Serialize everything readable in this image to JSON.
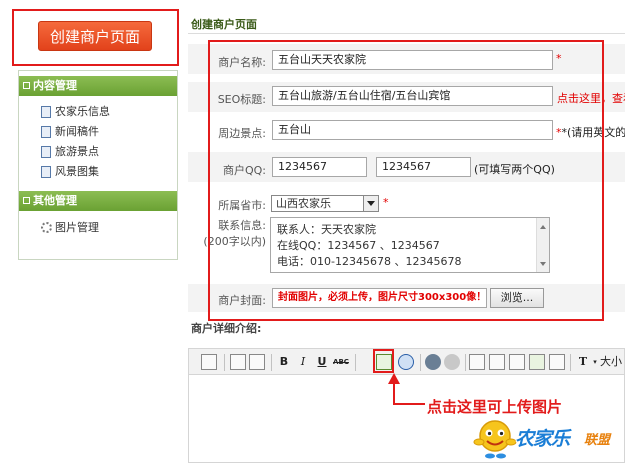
{
  "create_button": {
    "label": "创建商户页面"
  },
  "sidebar": {
    "sections": [
      {
        "title": "内容管理",
        "items": [
          "农家乐信息",
          "新闻稿件",
          "旅游景点",
          "风景图集"
        ]
      },
      {
        "title": "其他管理",
        "items": [
          "图片管理"
        ]
      }
    ]
  },
  "page_title": "创建商户页面",
  "form": {
    "name_label": "商户名称:",
    "name_value": "五台山天天农家院",
    "seo_label": "SEO标题:",
    "seo_value": "五台山旅游/五台山住宿/五台山宾馆",
    "seo_note": "点击这里，查看",
    "scenic_label": "周边景点:",
    "scenic_value": "五台山",
    "scenic_note": "*(请用英文的\",",
    "qq_label": "商户QQ:",
    "qq1": "1234567",
    "qq2": "1234567",
    "qq_note": "(可填写两个QQ)",
    "province_label": "所属省市:",
    "province_value": "山西农家乐",
    "contact_label": "联系信息:",
    "contact_sub": "(200字以内)",
    "contact_lines": [
      "联系人：天天农家院",
      "在线QQ：1234567 、1234567",
      "电话：010-12345678 、12345678"
    ],
    "cover_label": "商户封面:",
    "cover_value": "封面图片，必须上传，图片尺寸300x300像！",
    "browse_label": "浏览...",
    "required_mark": "*"
  },
  "detail_label": "商户详细介绍:",
  "toolbar": {
    "size_label": "大小"
  },
  "callout": "点击这里可上传图片",
  "logo": {
    "main": "农家乐",
    "sub": "联盟"
  },
  "colors": {
    "accent_red": "#e21b1b",
    "sidebar_green": "#6aa133",
    "logo_blue": "#1b7ed6"
  }
}
